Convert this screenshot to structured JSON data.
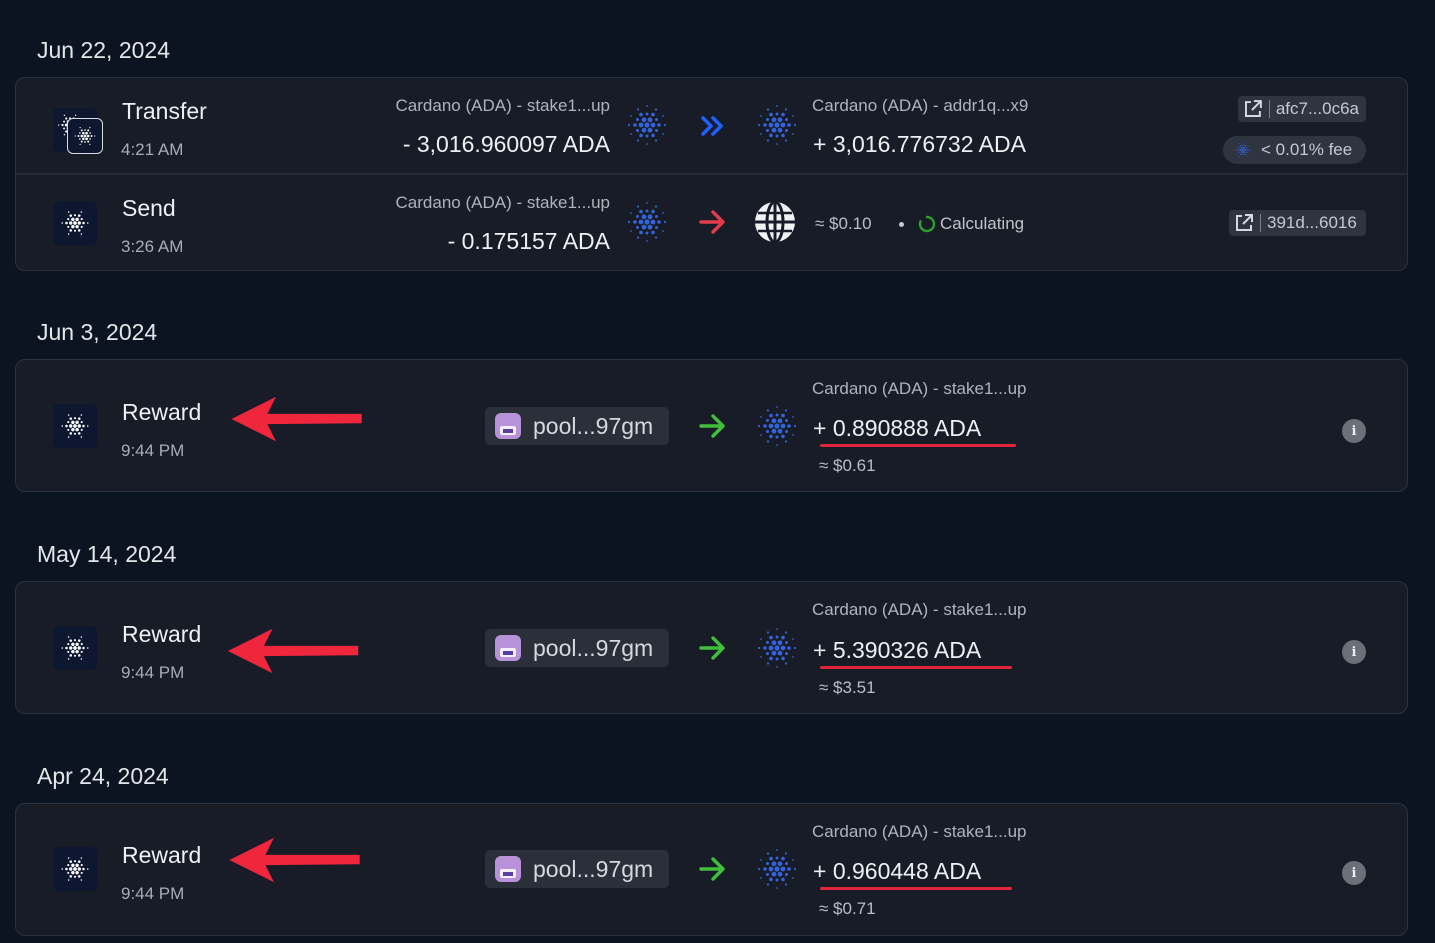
{
  "groups": [
    {
      "date": "Jun 22, 2024",
      "transactions": [
        {
          "type": "Transfer",
          "time": "4:21 AM",
          "from_account": "Cardano (ADA) - stake1...up",
          "from_amount": "- 3,016.960097 ADA",
          "to_account": "Cardano (ADA) - addr1q...x9",
          "to_amount": "+ 3,016.776732 ADA",
          "hash": "afc7...0c6a",
          "fee": "< 0.01% fee"
        },
        {
          "type": "Send",
          "time": "3:26 AM",
          "from_account": "Cardano (ADA) - stake1...up",
          "from_amount": "- 0.175157 ADA",
          "usd_value": "≈ $0.10",
          "status": "Calculating",
          "hash": "391d...6016"
        }
      ]
    },
    {
      "date": "Jun 3, 2024",
      "transactions": [
        {
          "type": "Reward",
          "time": "9:44 PM",
          "pool": "pool...97gm",
          "to_account": "Cardano (ADA) - stake1...up",
          "to_amount": "+ 0.890888 ADA",
          "usd_value": "≈ $0.61"
        }
      ]
    },
    {
      "date": "May 14, 2024",
      "transactions": [
        {
          "type": "Reward",
          "time": "9:44 PM",
          "pool": "pool...97gm",
          "to_account": "Cardano (ADA) - stake1...up",
          "to_amount": "+ 5.390326 ADA",
          "usd_value": "≈ $3.51"
        }
      ]
    },
    {
      "date": "Apr 24, 2024",
      "transactions": [
        {
          "type": "Reward",
          "time": "9:44 PM",
          "pool": "pool...97gm",
          "to_account": "Cardano (ADA) - stake1...up",
          "to_amount": "+ 0.960448 ADA",
          "usd_value": "≈ $0.71"
        }
      ]
    }
  ],
  "icons": {
    "cardano": "cardano-icon",
    "transfer_arrow": "double-chevron-right-icon",
    "send_arrow": "arrow-right-icon",
    "reward_arrow": "arrow-right-icon",
    "external_link": "external-link-icon",
    "globe": "globe-icon",
    "info": "info-icon",
    "spinner": "loading-spinner-icon",
    "pool_avatar": "pool-avatar-icon"
  },
  "info_label": "i",
  "colors": {
    "background": "#0c1421",
    "card": "#171c27",
    "transfer_arrow": "#1f5eff",
    "send_arrow": "#e23c4a",
    "reward_arrow": "#3fbf3a",
    "annotation": "#f0263d",
    "cardano_blue": "#2e5bd6"
  }
}
